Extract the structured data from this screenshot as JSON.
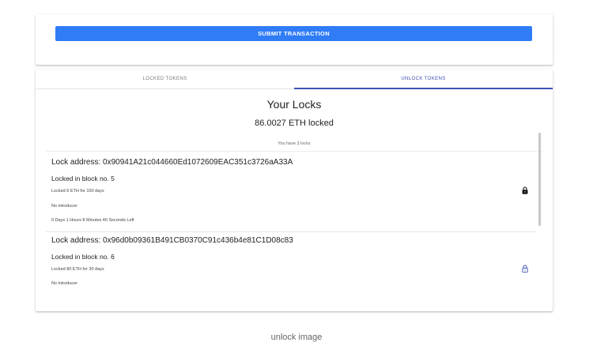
{
  "top_card": {
    "submit_label": "SUBMIT TRANSACTION"
  },
  "tabs": [
    {
      "label": "LOCKED TOKENS",
      "active": false
    },
    {
      "label": "UNLOCK TOKENS",
      "active": true
    }
  ],
  "locks": {
    "title": "Your Locks",
    "total": "86.0027 ETH locked",
    "count_text": "You have 3 locks",
    "items": [
      {
        "address": "Lock address: 0x90941A21c044660Ed1072609EAC351c3726aA33A",
        "block": "Locked in block no. 5",
        "amount": "Locked 6 ETH for 100 days",
        "introducer": "No introducer",
        "time_left": "0 Days 1 Hours 8 Minutes 40 Seconds Left",
        "icon": "lock-closed-icon"
      },
      {
        "address": "Lock address: 0x96d0b09361B491CB0370C91c436b4e81C1D08c83",
        "block": "Locked in block no. 6",
        "amount": "Locked 80 ETH for 30 days",
        "introducer": "No introducer",
        "icon": "lock-open-icon"
      }
    ]
  },
  "colors": {
    "accent": "#2f7cf6",
    "tab_indicator": "#3f51b5"
  },
  "caption": "unlock image"
}
